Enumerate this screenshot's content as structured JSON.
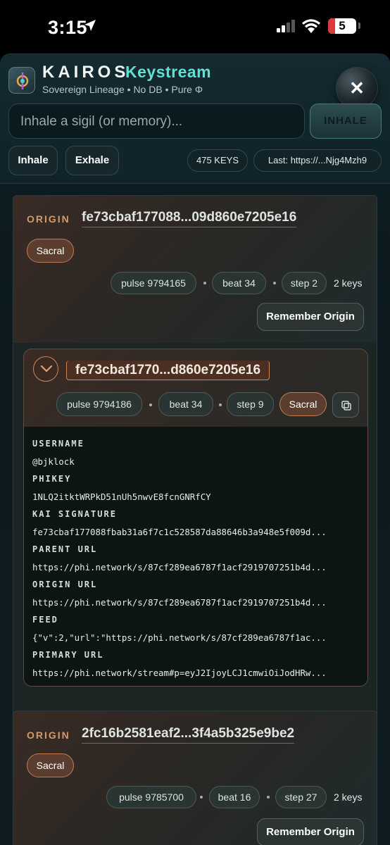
{
  "status_bar": {
    "time": "3:15",
    "battery": "5"
  },
  "header": {
    "brand": "KAIROS",
    "brand_sub": "Keystream",
    "tagline": "Sovereign Lineage • No DB • Pure Φ",
    "close_label": "✕"
  },
  "search": {
    "placeholder": "Inhale a sigil (or memory)...",
    "button_label": "INHALE"
  },
  "actions": {
    "inhale": "Inhale",
    "exhale": "Exhale",
    "keys_count": "475 KEYS",
    "last": "Last: https://...Njg4Mzh9"
  },
  "origins": [
    {
      "label": "ORIGIN",
      "hash": "fe73cbaf177088...09d860e7205e16",
      "chakra": "Sacral",
      "pulse": "pulse 9794165",
      "beat": "beat 34",
      "step": "step 2",
      "keys": "2 keys",
      "remember": "Remember Origin"
    },
    {
      "label": "ORIGIN",
      "hash": "2fc16b2581eaf2...3f4a5b325e9be2",
      "chakra": "Sacral",
      "pulse": "pulse 9785700",
      "beat": "beat 16",
      "step": "step 27",
      "keys": "2 keys",
      "remember": "Remember Origin"
    }
  ],
  "child": {
    "hash": "fe73cbaf1770...d860e7205e16",
    "pulse": "pulse 9794186",
    "beat": "beat 34",
    "step": "step 9",
    "chakra": "Sacral",
    "details": [
      {
        "label": "USERNAME",
        "value": "@bjklock"
      },
      {
        "label": "PHIKEY",
        "value": "1NLQ2itktWRPkD51nUh5nwvE8fcnGNRfCY"
      },
      {
        "label": "KAI SIGNATURE",
        "value": "fe73cbaf177088fbab31a6f7c1c528587da88646b3a948e5f009d..."
      },
      {
        "label": "PARENT URL",
        "value": "https://phi.network/s/87cf289ea6787f1acf2919707251b4d..."
      },
      {
        "label": "ORIGIN URL",
        "value": "https://phi.network/s/87cf289ea6787f1acf2919707251b4d..."
      },
      {
        "label": "FEED",
        "value": "{\"v\":2,\"url\":\"https://phi.network/s/87cf289ea6787f1ac..."
      },
      {
        "label": "PRIMARY URL",
        "value": "https://phi.network/stream#p=eyJ2IjoyLCJ1cmwiOiJodHRw..."
      }
    ]
  }
}
